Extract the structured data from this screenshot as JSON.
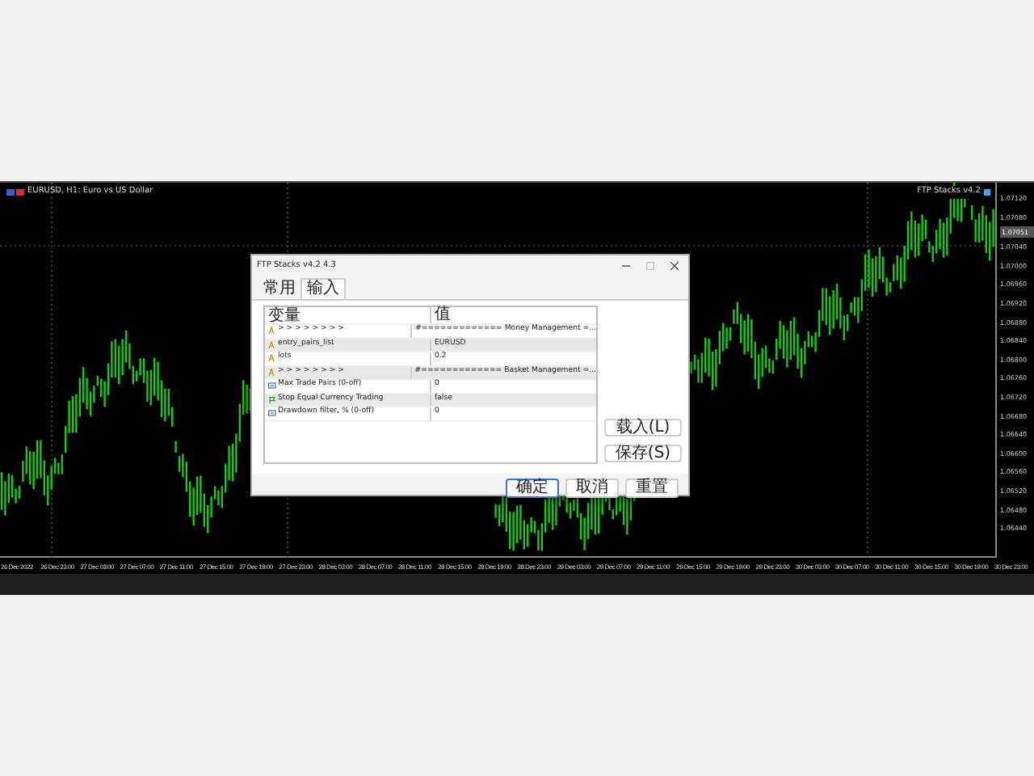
{
  "chart": {
    "symbol_label": "EURUSD, H1: Euro vs US Dollar",
    "indicator_label": "FTP Stacks v4.2",
    "price_labels": [
      "1.07120",
      "1.07080",
      "1.07040",
      "1.07000",
      "1.06960",
      "1.06920",
      "1.06880",
      "1.06840",
      "1.06800",
      "1.06760",
      "1.06720",
      "1.06680",
      "1.06640",
      "1.06600",
      "1.06560",
      "1.06520",
      "1.06480",
      "1.06440"
    ],
    "current_price": "1.07051",
    "time_labels": [
      "26 Dec 2022",
      "26 Dec 23:00",
      "27 Dec 03:00",
      "27 Dec 07:00",
      "27 Dec 11:00",
      "27 Dec 15:00",
      "27 Dec 19:00",
      "27 Dec 23:00",
      "28 Dec 03:00",
      "28 Dec 07:00",
      "28 Dec 11:00",
      "28 Dec 15:00",
      "28 Dec 19:00",
      "28 Dec 23:00",
      "29 Dec 03:00",
      "29 Dec 07:00",
      "29 Dec 11:00",
      "29 Dec 15:00",
      "29 Dec 19:00",
      "29 Dec 23:00",
      "30 Dec 03:00",
      "30 Dec 07:00",
      "30 Dec 11:00",
      "30 Dec 15:00",
      "30 Dec 19:00",
      "30 Dec 23:00"
    ]
  },
  "dialog": {
    "title": "FTP Stacks v4.2 4.3",
    "tabs": [
      {
        "label": "常用",
        "selected": false
      },
      {
        "label": "输入",
        "selected": true
      }
    ],
    "columns": [
      "变量",
      "值"
    ],
    "rows": [
      {
        "kind": "text",
        "name": "> > > > > > > >",
        "value": "#============= Money Management =..."
      },
      {
        "kind": "text",
        "name": "entry_pairs_list",
        "value": "EURUSD"
      },
      {
        "kind": "text",
        "name": "lots",
        "value": "0.2"
      },
      {
        "kind": "text",
        "name": "> > > > > > > >",
        "value": "#============= Basket Management =..."
      },
      {
        "kind": "number",
        "name": "Max Trade Pairs (0-off)",
        "value": "0"
      },
      {
        "kind": "flag",
        "name": "Stop Equal Currency Trading",
        "value": "false"
      },
      {
        "kind": "number",
        "name": "Drawdown filter, % (0-off)",
        "value": "0"
      }
    ],
    "side_buttons": [
      "载入(L)",
      "保存(S)"
    ],
    "buttons": [
      {
        "label": "确定",
        "default": true
      },
      {
        "label": "取消",
        "default": false
      },
      {
        "label": "重置",
        "default": false
      }
    ]
  }
}
